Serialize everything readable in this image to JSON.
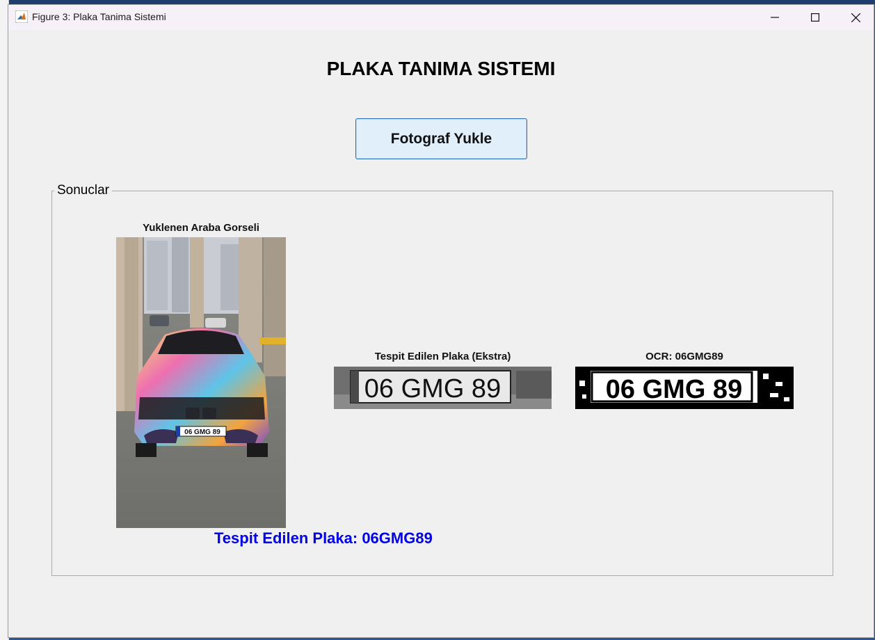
{
  "window": {
    "title": "Figure 3: Plaka Tanima Sistemi",
    "controls": [
      "minimize",
      "maximize",
      "close"
    ]
  },
  "main": {
    "title": "PLAKA TANIMA SISTEMI",
    "upload_button": "Fotograf Yukle"
  },
  "results": {
    "panel_title": "Sonuclar",
    "car_image_caption": "Yuklenen Araba Gorseli",
    "plate_image_caption": "Tespit Edilen Plaka (Ekstra)",
    "ocr_caption": "OCR: 06GMG89",
    "car_plate_text": "06 GMG 89",
    "plate_crop_text": "06 GMG 89",
    "ocr_binary_text": "06 GMG 89",
    "detected_text": "Tespit Edilen Plaka: 06GMG89",
    "detected_color": "#0000e6"
  }
}
